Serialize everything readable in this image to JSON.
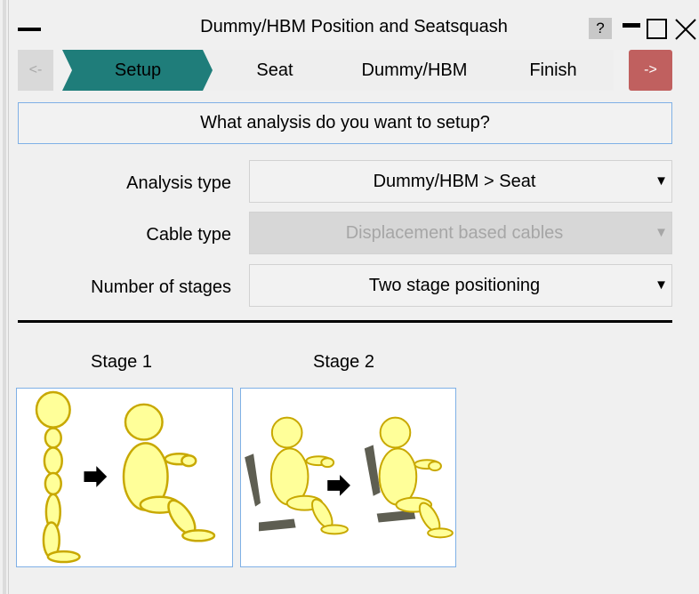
{
  "window": {
    "title": "Dummy/HBM Position and Seatsquash",
    "help_label": "?"
  },
  "stepbar": {
    "back_label": "<-",
    "next_label": "->",
    "steps": [
      {
        "label": "Setup",
        "active": true
      },
      {
        "label": "Seat",
        "active": false
      },
      {
        "label": "Dummy/HBM",
        "active": false
      },
      {
        "label": "Finish",
        "active": false
      }
    ]
  },
  "question": "What analysis do you want to setup?",
  "form": {
    "analysis_type": {
      "label": "Analysis type",
      "value": "Dummy/HBM > Seat",
      "enabled": true
    },
    "cable_type": {
      "label": "Cable type",
      "value": "Displacement based cables",
      "enabled": false
    },
    "num_stages": {
      "label": "Number of stages",
      "value": "Two stage positioning",
      "enabled": true
    }
  },
  "stages": [
    {
      "label": "Stage 1"
    },
    {
      "label": "Stage 2"
    }
  ],
  "colors": {
    "active_step": "#1f7d7a",
    "inactive_step": "#eeeeee",
    "next_button": "#c0605f",
    "focus_border": "#7fb0e6",
    "figure_fill": "#ffff99",
    "figure_stroke": "#c8a800",
    "seat": "#5e5e52"
  }
}
